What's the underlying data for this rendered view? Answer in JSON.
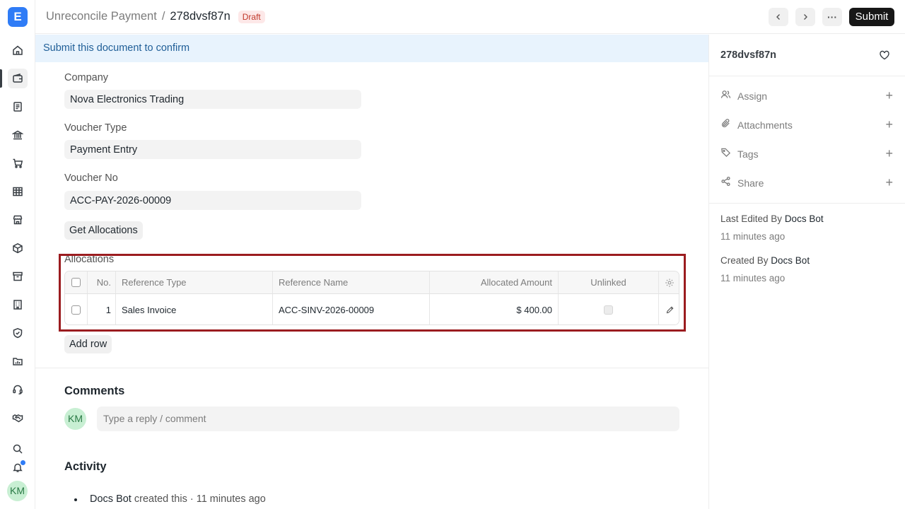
{
  "app": {
    "logo_letter": "E"
  },
  "rail": {
    "items": [
      "home-icon",
      "wallet-icon",
      "document-icon",
      "bank-icon",
      "cart-icon",
      "table-icon",
      "store-icon",
      "package-icon",
      "archive-icon",
      "building-icon",
      "shield-icon",
      "folder-chart-icon",
      "headset-icon",
      "handshake-icon",
      "search-icon",
      "bell-icon"
    ],
    "user_initials": "KM"
  },
  "header": {
    "doctype": "Unreconcile Payment",
    "separator": "/",
    "docname": "278dvsf87n",
    "status_badge": "Draft",
    "submit_label": "Submit",
    "more_label": "···"
  },
  "banner": {
    "text": "Submit this document to confirm"
  },
  "form": {
    "company_label": "Company",
    "company_value": "Nova Electronics Trading",
    "voucher_type_label": "Voucher Type",
    "voucher_type_value": "Payment Entry",
    "voucher_no_label": "Voucher No",
    "voucher_no_value": "ACC-PAY-2026-00009",
    "get_allocations_label": "Get Allocations"
  },
  "allocations": {
    "label": "Allocations",
    "columns": [
      "No.",
      "Reference Type",
      "Reference Name",
      "Allocated Amount",
      "Unlinked"
    ],
    "rows": [
      {
        "no": "1",
        "reference_type": "Sales Invoice",
        "reference_name": "ACC-SINV-2026-00009",
        "allocated_amount": "$ 400.00",
        "unlinked": false
      }
    ],
    "add_row_label": "Add row"
  },
  "comments": {
    "title": "Comments",
    "avatar_initials": "KM",
    "placeholder": "Type a reply / comment"
  },
  "activity": {
    "title": "Activity",
    "items": [
      {
        "who": "Docs Bot",
        "text": " created this · 11 minutes ago"
      }
    ]
  },
  "sidebar": {
    "title": "278dvsf87n",
    "actions": [
      "Assign",
      "Attachments",
      "Tags",
      "Share"
    ],
    "last_edited_prefix": "Last Edited By ",
    "last_edited_by": "Docs Bot",
    "last_edited_time": "11 minutes ago",
    "created_prefix": "Created By ",
    "created_by": "Docs Bot",
    "created_time": "11 minutes ago"
  },
  "colors": {
    "accent": "#2f7cf6",
    "highlight_border": "#9b1c1f",
    "draft_badge": "#c0392b",
    "banner_bg": "#e8f3fd"
  }
}
